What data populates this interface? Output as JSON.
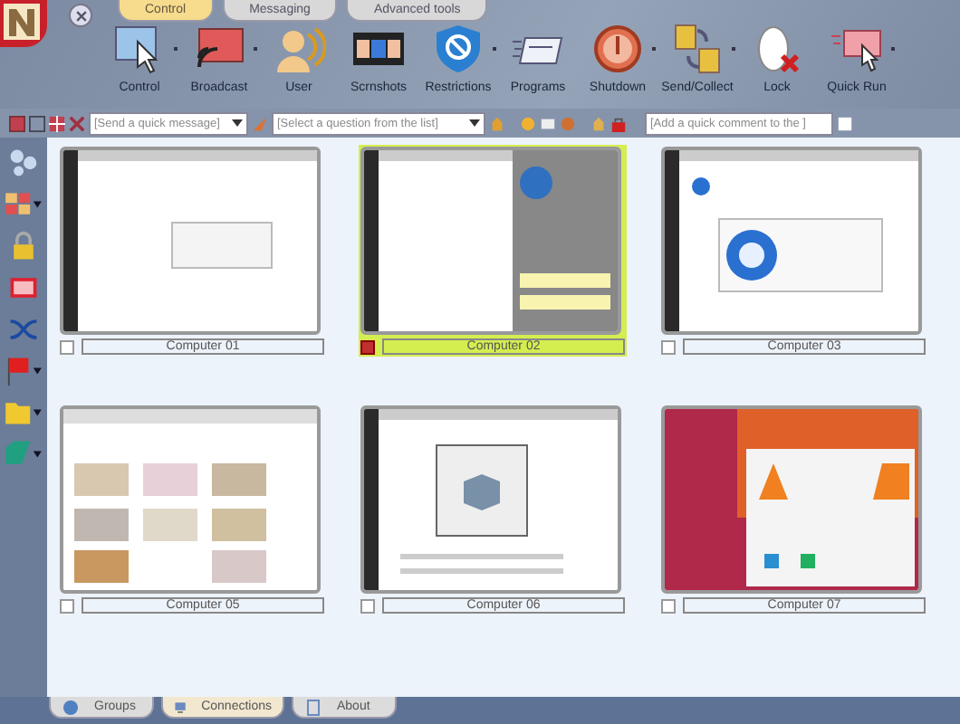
{
  "tabs": [
    {
      "label": "Control",
      "selected": true
    },
    {
      "label": "Messaging",
      "selected": false
    },
    {
      "label": "Advanced tools",
      "selected": false
    }
  ],
  "toolbar": [
    {
      "label": "Control",
      "menu": true
    },
    {
      "label": "Broadcast",
      "menu": true
    },
    {
      "label": "User",
      "menu": false
    },
    {
      "label": "Scrnshots",
      "menu": false
    },
    {
      "label": "Restrictions",
      "menu": true
    },
    {
      "label": "Programs",
      "menu": false
    },
    {
      "label": "Shutdown",
      "menu": true
    },
    {
      "label": "Send/Collect",
      "menu": true
    },
    {
      "label": "Lock",
      "menu": false
    },
    {
      "label": "Quick Run",
      "menu": true
    }
  ],
  "quickbar": {
    "message": {
      "placeholder": "[Send a quick message]"
    },
    "question": {
      "placeholder": "[Select a question from the list]"
    },
    "comment": {
      "placeholder": "[Add a quick comment to the ]"
    }
  },
  "computers": [
    {
      "name": "Computer 01",
      "selected": false,
      "checked": false
    },
    {
      "name": "Computer 02",
      "selected": true,
      "checked": true
    },
    {
      "name": "Computer 03",
      "selected": false,
      "checked": false
    },
    {
      "name": "Computer 05",
      "selected": false,
      "checked": false
    },
    {
      "name": "Computer 06",
      "selected": false,
      "checked": false
    },
    {
      "name": "Computer 07",
      "selected": false,
      "checked": false
    }
  ],
  "bottom_tabs": [
    {
      "label": "Groups",
      "selected": false
    },
    {
      "label": "Connections",
      "selected": true
    },
    {
      "label": "About",
      "selected": false
    }
  ]
}
